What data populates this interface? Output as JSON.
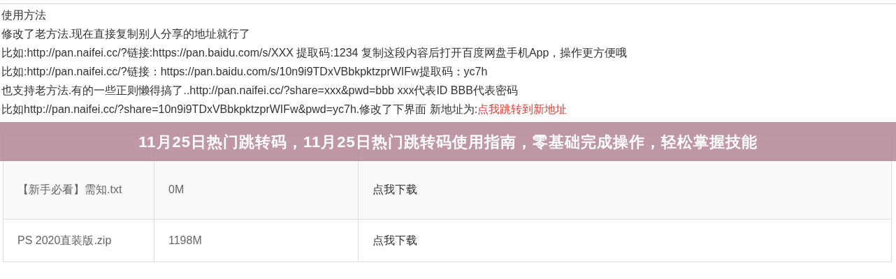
{
  "instructions": [
    "使用方法",
    "修改了老方法.现在直接复制别人分享的地址就行了",
    "比如:http://pan.naifei.cc/?链接:https://pan.baidu.com/s/XXX 提取码:1234 复制这段内容后打开百度网盘手机App，操作更方便哦",
    "比如:http://pan.naifei.cc/?链接：https://pan.baidu.com/s/10n9i9TDxVBbkpktzprWIFw提取码：yc7h",
    "也支持老方法.有的一些正则懒得搞了..http://pan.naifei.cc/?share=xxx&pwd=bbb xxx代表ID BBB代表密码"
  ],
  "last_line": {
    "text": "比如http://pan.naifei.cc/?share=10n9i9TDxVBbkpktzprWIFw&pwd=yc7h.修改了下界面 新地址为:",
    "link": "点我跳转到新地址"
  },
  "banner": {
    "title": "11月25日热门跳转码，11月25日热门跳转码使用指南，零基础完成操作，轻松掌握技能"
  },
  "table": {
    "rows": [
      {
        "name": "【新手必看】需知.txt",
        "size": "0M",
        "link": "点我下载"
      },
      {
        "name": "PS 2020直装版.zip",
        "size": "1198M",
        "link": "点我下载"
      }
    ]
  }
}
